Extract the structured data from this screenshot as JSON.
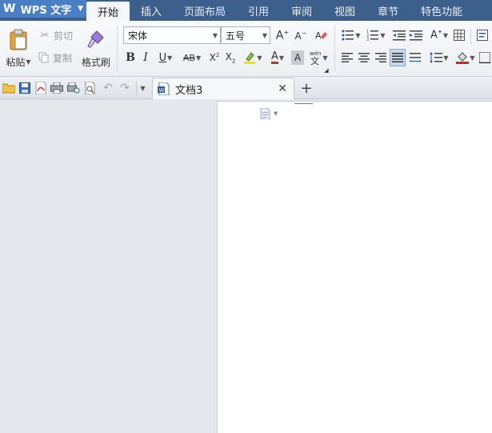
{
  "app": {
    "logo": "W",
    "name": "WPS 文字"
  },
  "menu_tabs": [
    "开始",
    "插入",
    "页面布局",
    "引用",
    "审阅",
    "视图",
    "章节",
    "特色功能"
  ],
  "clipboard": {
    "paste": "粘贴",
    "cut": "剪切",
    "copy": "复制",
    "format_painter": "格式刷"
  },
  "font": {
    "family": "宋体",
    "size": "五号"
  },
  "document": {
    "tab_title": "文档3"
  },
  "colors": {
    "menubar": "#3d5f8c",
    "app_button": "#4a7ec6",
    "highlight": "#ffe000",
    "font_color": "#e02020"
  }
}
